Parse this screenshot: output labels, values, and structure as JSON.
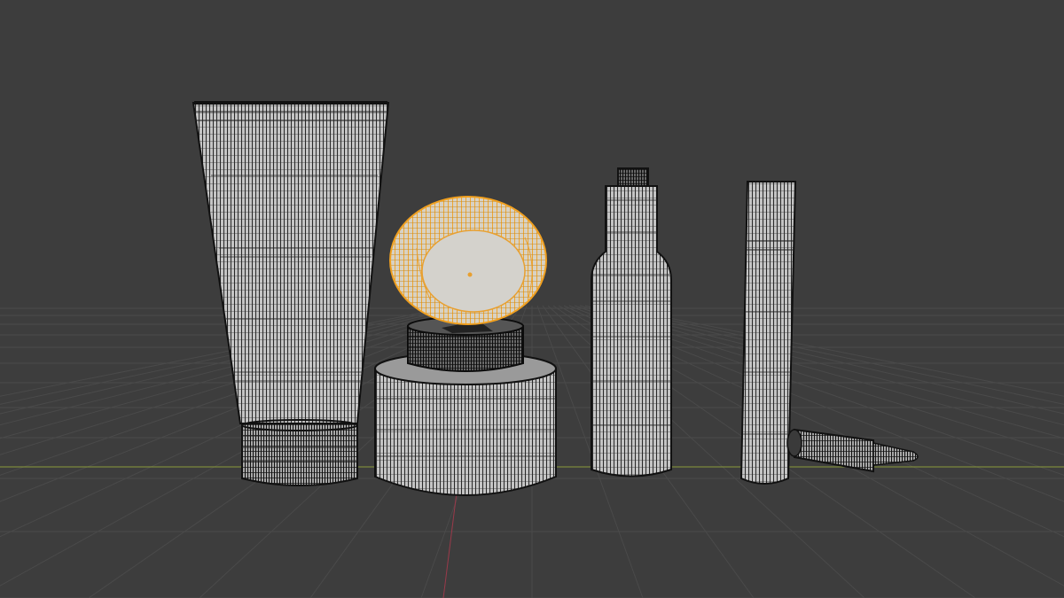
{
  "viewport": {
    "view": "3d-viewport-wireframe",
    "colors": {
      "background": "#3d3d3d",
      "grid": "#4a4a4a",
      "x_axis": "#8a9a3a",
      "y_axis": "#9a3a4a",
      "mesh_fill": "#c4c4c4",
      "mesh_wire": "#111111",
      "selection": "#f0a020",
      "origin_dot": "#e8a030"
    }
  },
  "scene": {
    "objects": [
      {
        "id": "tube",
        "kind": "squeeze-tube",
        "selected": false
      },
      {
        "id": "jar",
        "kind": "cream-jar",
        "selected": false
      },
      {
        "id": "jar_lid",
        "kind": "jar-lid",
        "selected": true,
        "active": true
      },
      {
        "id": "bottle",
        "kind": "serum-bottle",
        "selected": false
      },
      {
        "id": "vial",
        "kind": "slim-vial",
        "selected": false
      },
      {
        "id": "dropper",
        "kind": "dropper",
        "selected": false
      }
    ]
  }
}
